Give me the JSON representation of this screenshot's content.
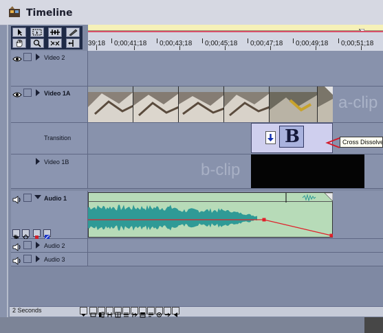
{
  "window": {
    "title": "Timeline"
  },
  "ruler": {
    "timecodes": [
      "39;18",
      "0;00;41;18",
      "0;00;43;18",
      "0;00;45;18",
      "0;00;47;18",
      "0;00;49;18",
      "0;00;51;18"
    ]
  },
  "tracks": {
    "video2": {
      "label": "Video 2"
    },
    "video1a": {
      "label": "Video 1A",
      "ghost_label": "a-clip"
    },
    "transition": {
      "label": "Transition",
      "glyph": "B",
      "tooltip": "Cross Dissolve"
    },
    "video1b": {
      "label": "Video 1B",
      "ghost_label": "b-clip"
    },
    "audio1": {
      "label": "Audio 1"
    },
    "audio2": {
      "label": "Audio 2"
    },
    "audio3": {
      "label": "Audio 3"
    }
  },
  "bottom_bar": {
    "zoom_label": "2 Seconds"
  },
  "colors": {
    "window_bg": "#8a94ad",
    "waveform": "#2f9a96",
    "rubberband": "#e0202a",
    "audio_clip": "#b7dbb8",
    "transition_block": "#cfcfee",
    "ruler_bar": "#f6f1b8"
  }
}
